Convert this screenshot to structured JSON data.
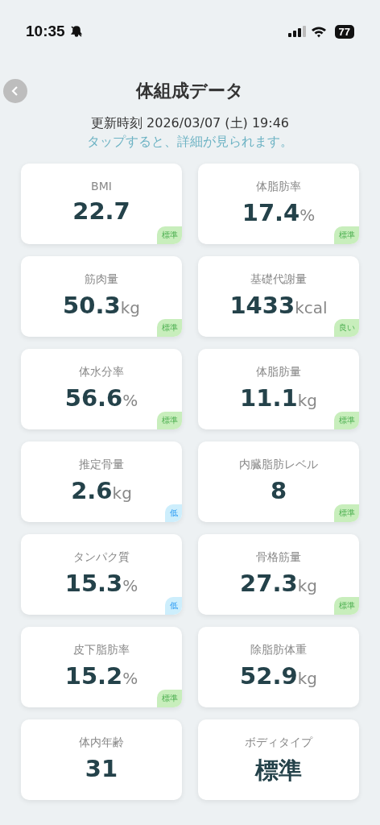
{
  "status_bar": {
    "time": "10:35",
    "battery": "77"
  },
  "header": {
    "title": "体組成データ"
  },
  "updated": "更新時刻 2026/03/07 (土) 19:46",
  "hint": "タップすると、詳細が見られます。",
  "metrics": [
    {
      "label": "BMI",
      "value": "22.7",
      "badge": "標準",
      "color": "#c8eebc"
    },
    {
      "label": "体脂肪率",
      "value": "17.4",
      "unit": "%",
      "badge": "標準",
      "color": "#c8eebc"
    },
    {
      "label": "筋肉量",
      "value": "50.3",
      "unit": "kg",
      "badge": "標準",
      "color": "#c8eebc"
    },
    {
      "label": "基礎代謝量",
      "value": "1433",
      "unit": "kcal",
      "badge": "良い",
      "color": "#c8eebc"
    },
    {
      "label": "体水分率",
      "value": "56.6",
      "unit": "%",
      "badge": "標準",
      "color": "#c8eebc"
    },
    {
      "label": "体脂肪量",
      "value": "11.1",
      "unit": "kg",
      "badge": "標準",
      "color": "#c8eebc"
    },
    {
      "label": "推定骨量",
      "value": "2.6",
      "unit": "kg",
      "badge": "低",
      "color": "#cdeefc"
    },
    {
      "label": "内臓脂肪レベル",
      "value": "8",
      "badge": "標準",
      "color": "#c8eebc"
    },
    {
      "label": "タンパク質",
      "value": "15.3",
      "unit": "%",
      "badge": "低",
      "color": "#cdeefc"
    },
    {
      "label": "骨格筋量",
      "value": "27.3",
      "unit": "kg",
      "badge": "標準",
      "color": "#c8eebc"
    },
    {
      "label": "皮下脂肪率",
      "value": "15.2",
      "unit": "%",
      "badge": "標準",
      "color": "#c8eebc"
    },
    {
      "label": "除脂肪体重",
      "value": "52.9",
      "unit": "kg"
    },
    {
      "label": "体内年齢",
      "value": "31"
    },
    {
      "label": "ボディタイプ",
      "value": "標準"
    }
  ]
}
